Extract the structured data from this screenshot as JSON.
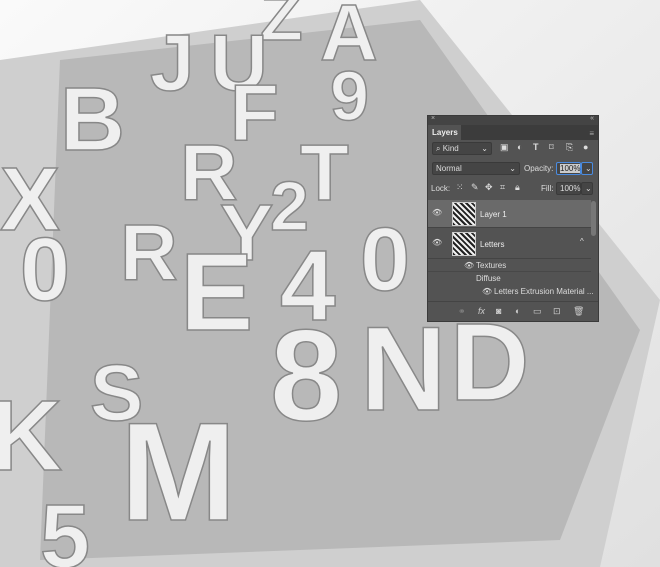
{
  "artwork": {
    "letters": [
      "Z",
      "A",
      "J",
      "U",
      "B",
      "F",
      "9",
      "R",
      "T",
      "X",
      "0",
      "R",
      "Y",
      "2",
      "E",
      "4",
      "0",
      "S",
      "8",
      "N",
      "D",
      "K",
      "M",
      "5"
    ]
  },
  "panel": {
    "close_icon": "×",
    "collapse_icon": "«",
    "tab": "Layers",
    "filter": {
      "label": "Kind",
      "icons": [
        "image-filter-icon",
        "adjustment-filter-icon",
        "type-filter-icon",
        "shape-filter-icon",
        "smart-object-filter-icon"
      ]
    },
    "blend_mode": "Normal",
    "opacity_label": "Opacity:",
    "opacity_value": "100%",
    "lock_label": "Lock:",
    "fill_label": "Fill:",
    "fill_value": "100%",
    "layers": [
      {
        "name": "Layer 1",
        "selected": true
      },
      {
        "name": "Letters",
        "selected": false
      }
    ],
    "sub_items": {
      "textures": "Textures",
      "diffuse": "Diffuse",
      "material": "Letters Extrusion Material ..."
    },
    "bottom_icons": [
      "link",
      "fx",
      "mask",
      "adjustment",
      "group",
      "new-layer",
      "trash"
    ],
    "fx_label": "fx"
  }
}
